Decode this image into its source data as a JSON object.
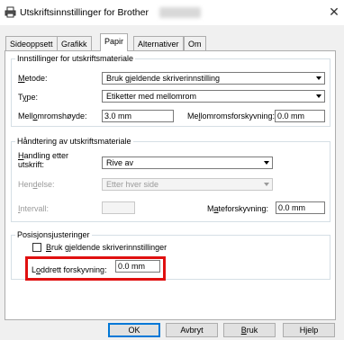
{
  "window": {
    "title": "Utskriftsinnstillinger for Brother"
  },
  "tabs": [
    "Sideoppsett",
    "Grafikk",
    "Papir",
    "Alternativer",
    "Om"
  ],
  "media_group": {
    "title": "Innstillinger for utskriftsmateriale",
    "method_label": "Metode:",
    "method_value": "Bruk gjeldende skriverinnstilling",
    "type_label": "Type:",
    "type_value": "Etiketter med mellomrom",
    "gap_height_label": "Mellomromshøyde:",
    "gap_height_value": "3.0 mm",
    "gap_offset_label": "Mellomromsforskyvning:",
    "gap_offset_value": "0.0 mm"
  },
  "handling_group": {
    "title": "Håndtering av utskriftsmateriale",
    "action_label_line1": "Handling etter",
    "action_label_line2": "utskrift:",
    "action_value": "Rive av",
    "event_label": "Hendelse:",
    "event_value": "Etter hver side",
    "interval_label": "Intervall:",
    "feed_offset_label": "Mateforskyvning:",
    "feed_offset_value": "0.0 mm"
  },
  "position_group": {
    "title": "Posisjonsjusteringer",
    "use_printer_setting_label": "Bruk gjeldende skriverinnstillinger",
    "use_printer_setting_checked": false,
    "vertical_offset_label": "Loddrett forskyvning:",
    "vertical_offset_value": "0.0 mm"
  },
  "buttons": {
    "ok": "OK",
    "cancel": "Avbryt",
    "apply": "Bruk",
    "help": "Hjelp"
  },
  "colors": {
    "highlight": "#e01010",
    "focus": "#0078d7"
  }
}
